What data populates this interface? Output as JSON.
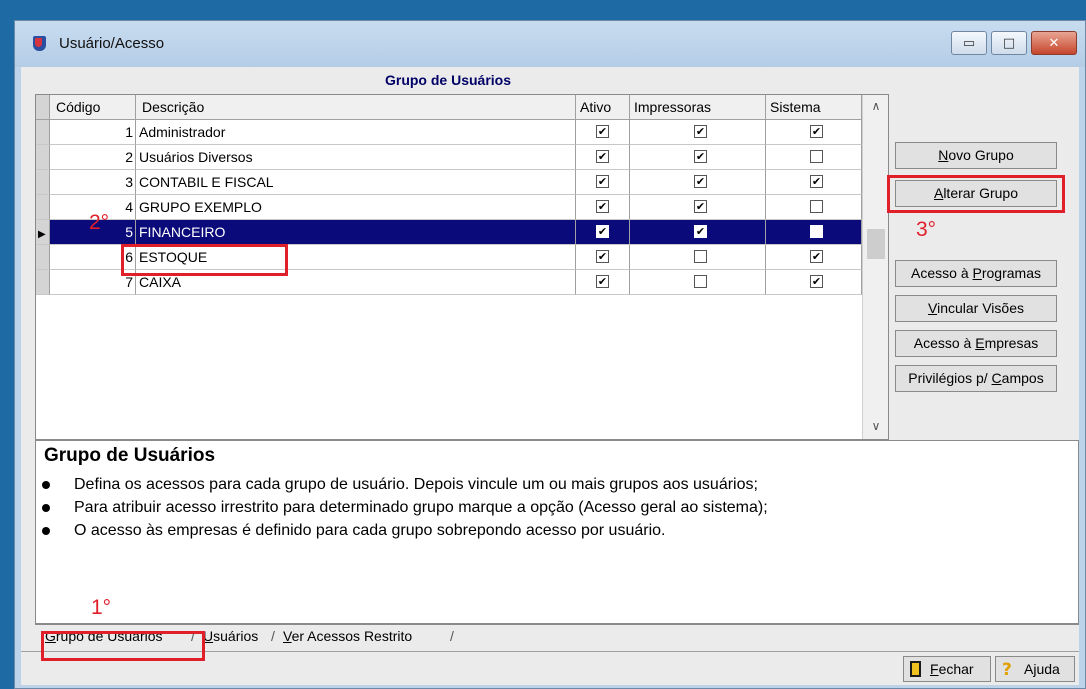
{
  "window": {
    "title": "Usuário/Acesso",
    "min_glyph": "▭",
    "max_glyph": "□",
    "close_glyph": "✕"
  },
  "header": {
    "title": "Grupo de Usuários"
  },
  "grid": {
    "columns": [
      "Código",
      "Descrição",
      "Ativo",
      "Impressoras",
      "Sistema"
    ],
    "rows": [
      {
        "code": "1",
        "desc": "Administrador",
        "ativo": true,
        "imp": true,
        "sis": true
      },
      {
        "code": "2",
        "desc": "Usuários Diversos",
        "ativo": true,
        "imp": true,
        "sis": false
      },
      {
        "code": "3",
        "desc": "CONTABIL E FISCAL",
        "ativo": true,
        "imp": true,
        "sis": true
      },
      {
        "code": "4",
        "desc": "GRUPO EXEMPLO",
        "ativo": true,
        "imp": true,
        "sis": false
      },
      {
        "code": "5",
        "desc": "FINANCEIRO",
        "ativo": true,
        "imp": true,
        "sis": false,
        "selected": true
      },
      {
        "code": "6",
        "desc": "ESTOQUE",
        "ativo": true,
        "imp": false,
        "sis": true
      },
      {
        "code": "7",
        "desc": "CAIXA",
        "ativo": true,
        "imp": false,
        "sis": true
      }
    ],
    "row_indicator": "▶",
    "check_glyph": "✔"
  },
  "buttons": {
    "novo": {
      "pre": "",
      "u": "N",
      "post": "ovo Grupo"
    },
    "alterar": {
      "pre": "",
      "u": "A",
      "post": "lterar Grupo"
    },
    "programas": {
      "pre": "Acesso à ",
      "u": "P",
      "post": "rogramas"
    },
    "visoes": {
      "pre": "",
      "u": "V",
      "post": "incular Visões"
    },
    "empresas": {
      "pre": "Acesso à ",
      "u": "E",
      "post": "mpresas"
    },
    "privilegios": {
      "pre": "Privilégios p/ ",
      "u": "C",
      "post": "ampos"
    }
  },
  "annotations": {
    "a1": "1°",
    "a2": "2°",
    "a3": "3°"
  },
  "info": {
    "title": "Grupo de Usuários",
    "items": [
      "Defina os acessos para cada grupo de usuário. Depois vincule um ou mais grupos aos usuários;",
      "Para atribuir acesso irrestrito para determinado grupo marque a opção (Acesso geral ao sistema);",
      "O acesso às empresas é definido para cada grupo sobrepondo acesso por usuário."
    ]
  },
  "tabs": [
    {
      "u": "G",
      "post": "rupo de Usuários"
    },
    {
      "u": "U",
      "post": "suários"
    },
    {
      "u": "V",
      "post": "er Acessos Restrito"
    }
  ],
  "bottom": {
    "fechar": {
      "u": "F",
      "post": "echar"
    },
    "ajuda": "Ajuda",
    "help_glyph": "?"
  },
  "colors": {
    "selection": "#0a0a7a",
    "annotation": "#e01f2b",
    "header": "#000066"
  }
}
